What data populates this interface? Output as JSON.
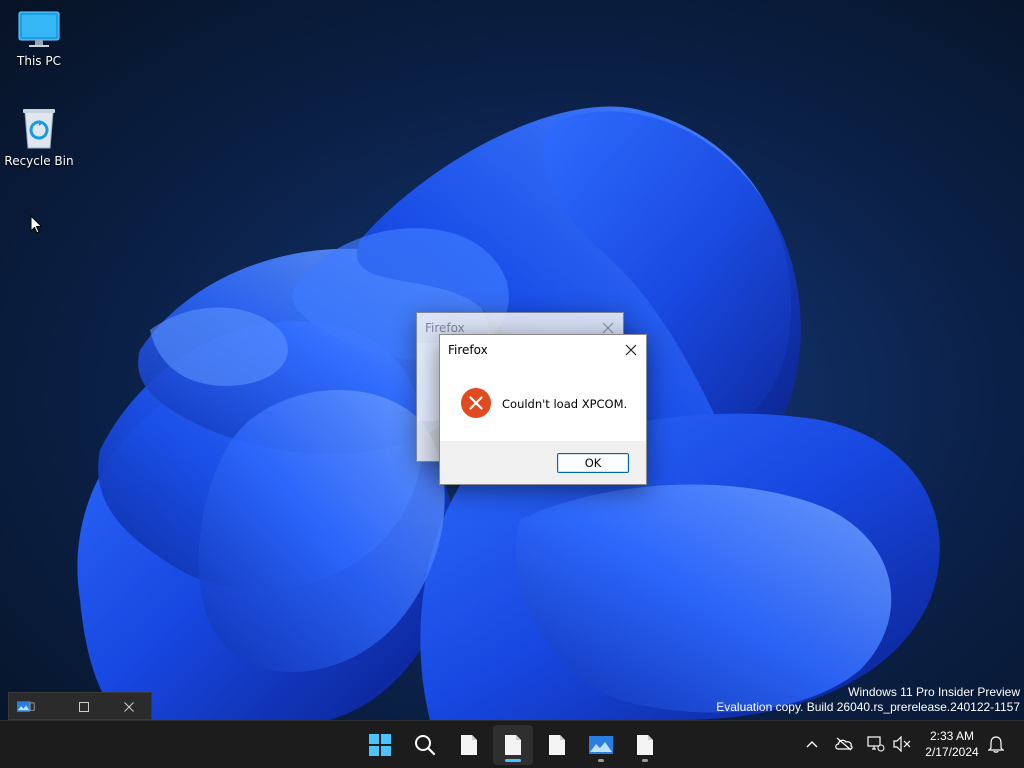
{
  "desktop": {
    "icons": [
      {
        "label": "This PC",
        "icon": "monitor-icon"
      },
      {
        "label": "Recycle Bin",
        "icon": "recycle-bin-icon"
      }
    ]
  },
  "dialogs": {
    "back": {
      "title": "Firefox"
    },
    "front": {
      "title": "Firefox",
      "message": "Couldn't load XPCOM.",
      "icon": "error-icon",
      "ok_label": "OK"
    }
  },
  "watermark": {
    "line1": "Windows 11 Pro Insider Preview",
    "line2": "Evaluation copy. Build 26040.rs_prerelease.240122-1157"
  },
  "taskbar": {
    "clock_time": "2:33 AM",
    "clock_date": "2/17/2024",
    "apps": [
      "start-icon",
      "search-icon",
      "file-icon",
      "file-icon",
      "file-icon",
      "photo-app-icon",
      "file-icon"
    ]
  },
  "colors": {
    "accent": "#0067c0",
    "error_red": "#e04a1e",
    "taskbar_bg": "#1c1c1c",
    "active_indicator": "#4cc2ff"
  }
}
